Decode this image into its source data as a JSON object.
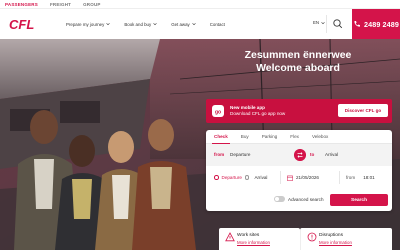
{
  "topbar": {
    "items": [
      "PASSENGERS",
      "FREIGHT",
      "GROUP"
    ]
  },
  "header": {
    "logo_text": "CFL",
    "nav": [
      "Prepare my journey",
      "Book and buy",
      "Get away",
      "Contact"
    ],
    "language": "EN",
    "phone": "2489 2489"
  },
  "hero": {
    "headline_line1": "Zesummen ënnerwee",
    "headline_line2": "Welcome aboard"
  },
  "app_banner": {
    "title": "New mobile app",
    "subtitle": "Download CFL go app now",
    "button": "Discover CFL go"
  },
  "booking": {
    "tabs": [
      "Check",
      "Buy",
      "Parking",
      "Flex",
      "Velebox"
    ],
    "active_tab": "Check",
    "from_label": "from",
    "from_value": "Departure",
    "to_label": "to",
    "to_value": "Arrival",
    "departure_option": "Departure",
    "arrival_option": "Arrival",
    "date": "21/05/2026",
    "time_label": "from",
    "time_value": "18:01",
    "advanced_search": "Advanced search",
    "search_button": "Search"
  },
  "cards": {
    "works_title": "Work sites",
    "works_link": "More information",
    "disruptions_title": "Disruptions",
    "disruptions_link": "More information"
  },
  "colors": {
    "brand_red": "#d4144a"
  },
  "icons": [
    "search-icon",
    "phone-icon",
    "chevron-down-icon",
    "swap-icon",
    "calendar-icon",
    "app-icon",
    "worksite-icon",
    "disruption-icon"
  ]
}
